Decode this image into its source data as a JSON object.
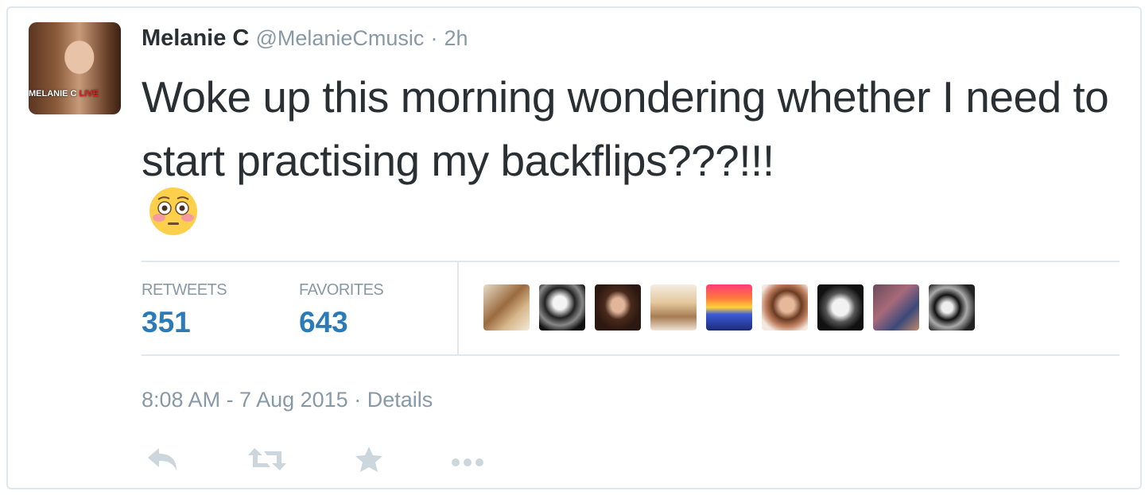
{
  "tweet": {
    "author_name": "Melanie C",
    "handle": "@MelanieCmusic",
    "separator": "·",
    "age": "2h",
    "avatar_brand": "MELANIE C",
    "avatar_brand_live": "LIVE",
    "text": "Woke up this morning wondering whether I need to start practising my backflips???!!!",
    "emoji": "flushed-face-emoji"
  },
  "stats": {
    "retweets_label": "RETWEETS",
    "retweets_count": "351",
    "favorites_label": "FAVORITES",
    "favorites_count": "643",
    "favoriter_avatars": 9
  },
  "meta": {
    "timestamp": "8:08 AM - 7 Aug 2015",
    "separator": "·",
    "details_label": "Details"
  },
  "actions": [
    "reply-icon",
    "retweet-icon",
    "favorite-icon",
    "more-icon"
  ],
  "colors": {
    "text": "#292f33",
    "muted": "#8899a6",
    "link": "#2b7bb9",
    "border": "#e1e8ed",
    "icon": "#ccd6dd"
  }
}
